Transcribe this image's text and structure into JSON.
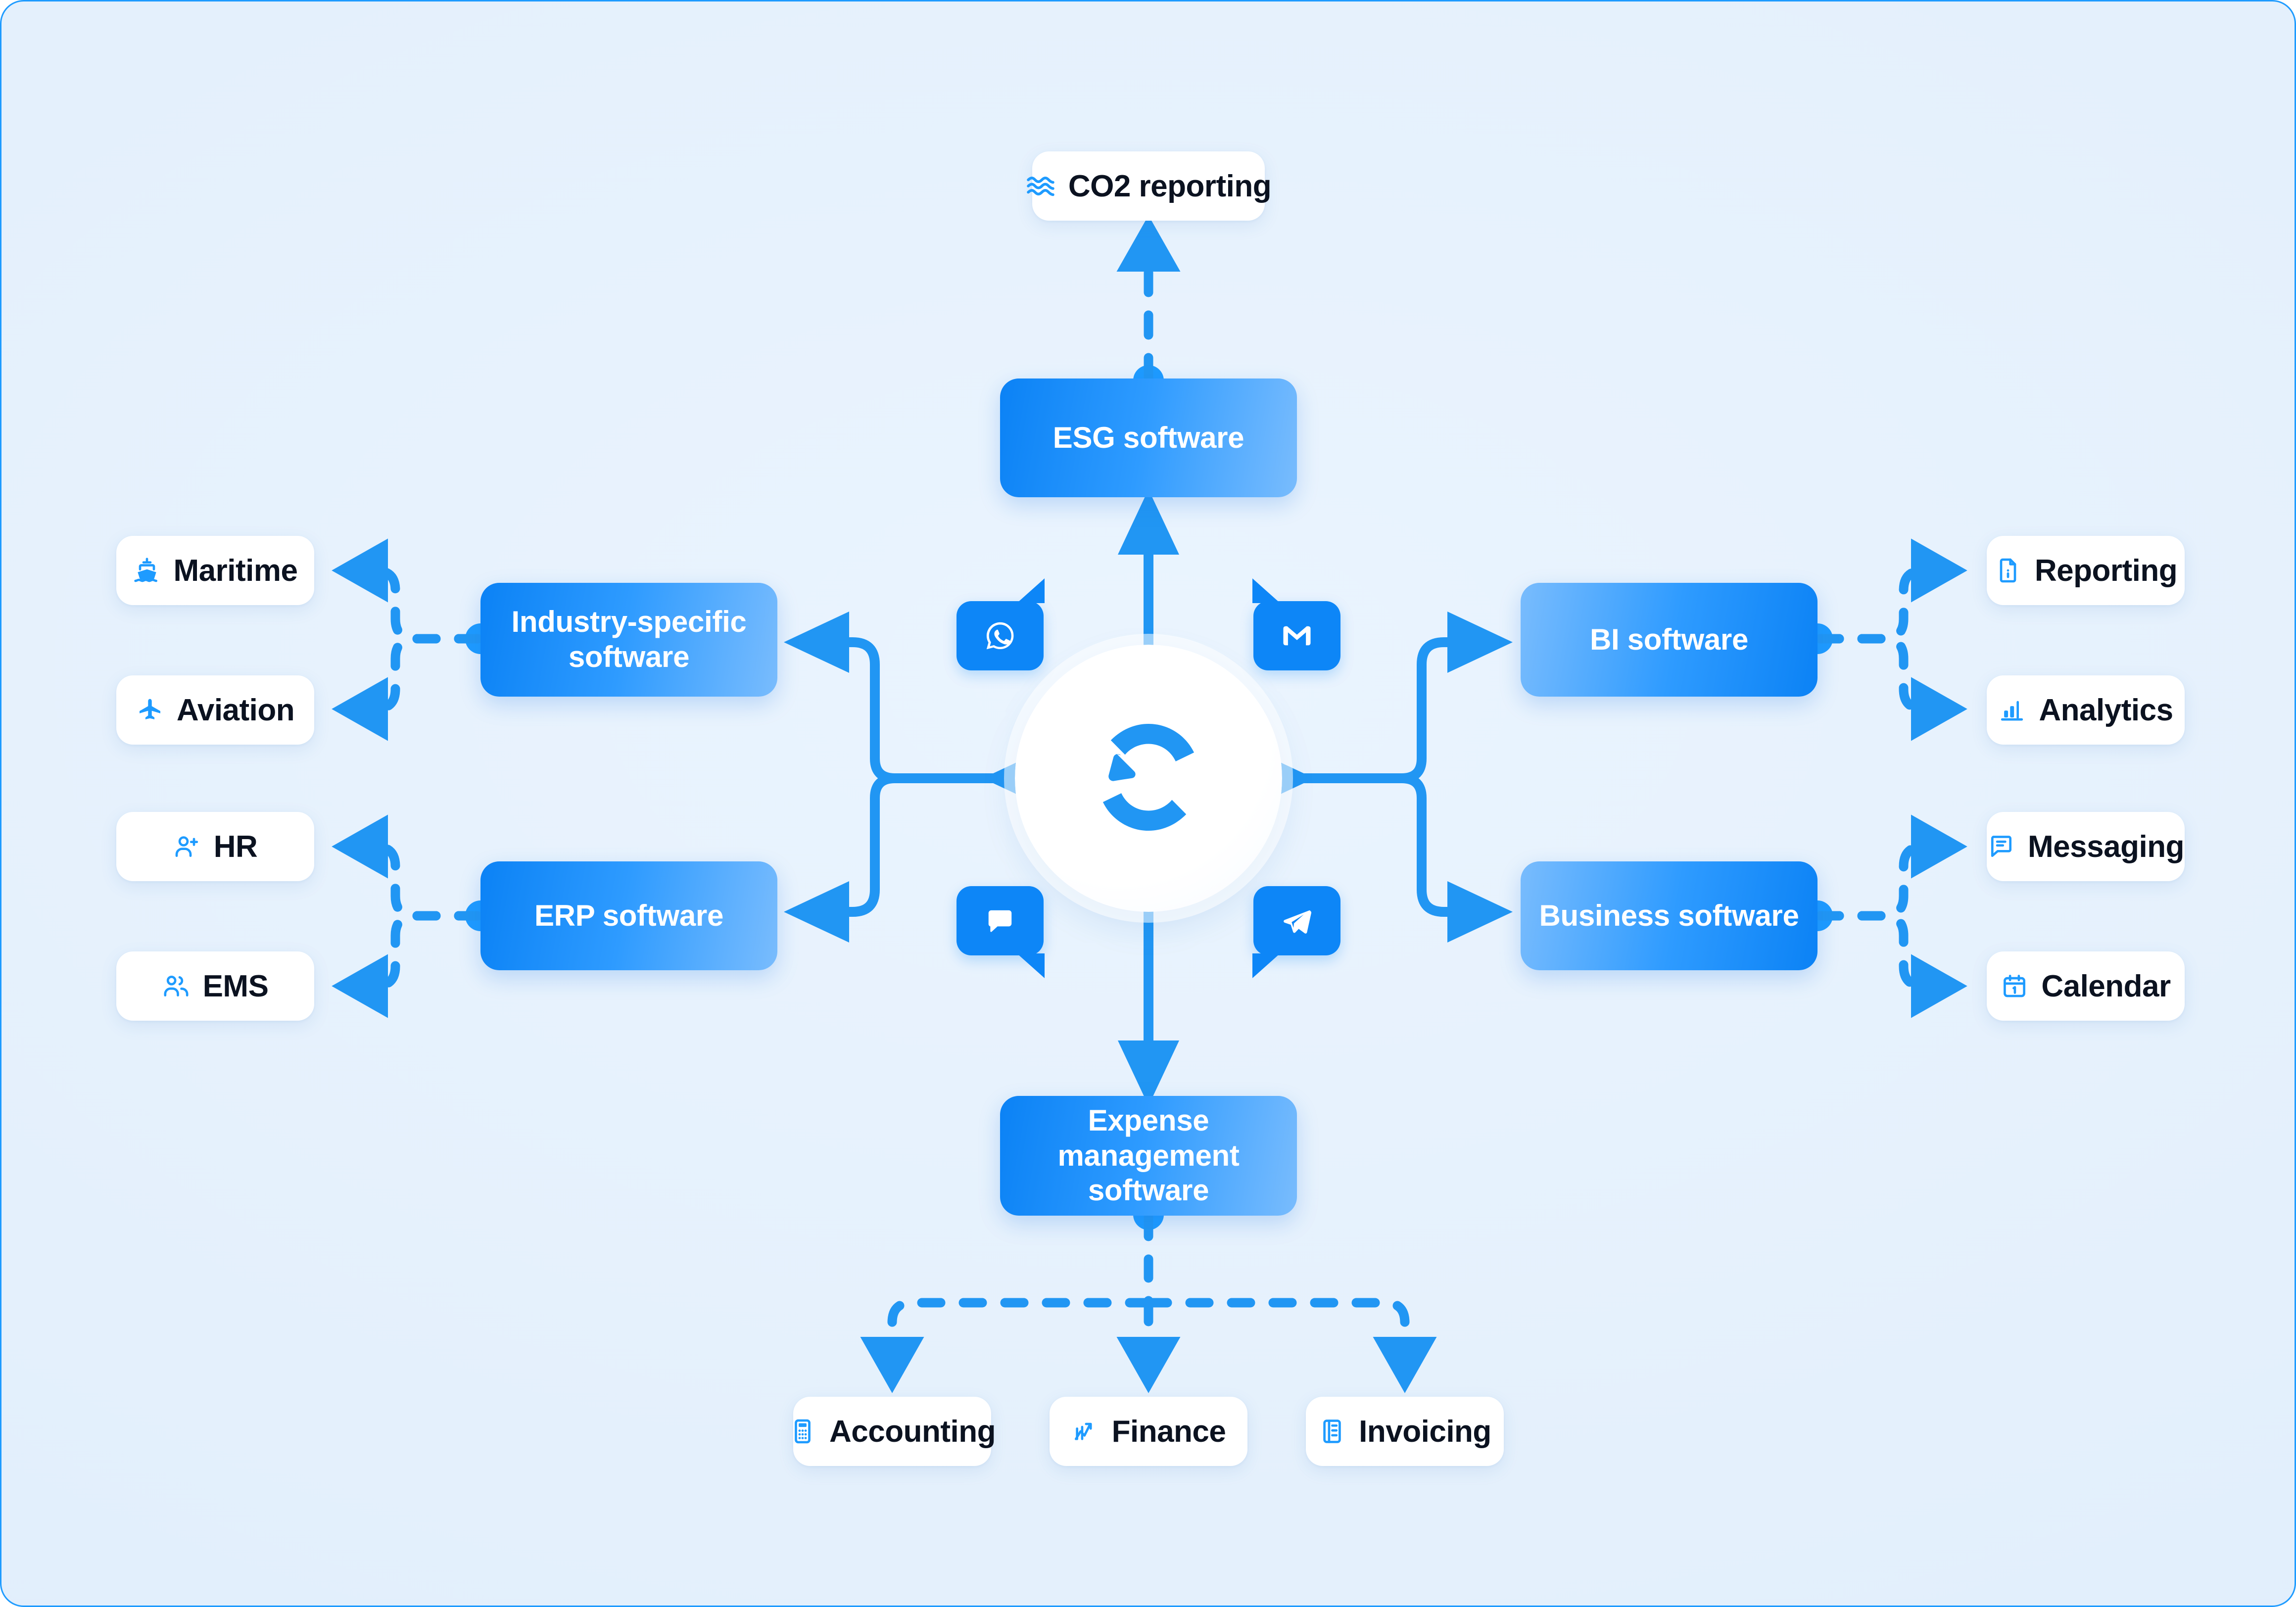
{
  "colors": {
    "accent": "#1e9bff",
    "line": "#2196f3",
    "box_dark": "#0b82f5",
    "box_light": "#79bcfd",
    "card_bg": "#ffffff",
    "page_bg": "#e4f0fc",
    "text_dark": "#0b1220",
    "text_light": "#ffffff"
  },
  "hub": {
    "name": "sync-hub",
    "center_icon": "sync-arrows-icon",
    "bubbles": [
      {
        "id": "whatsapp",
        "icon": "whatsapp-icon",
        "corner": "top-left"
      },
      {
        "id": "gmail",
        "icon": "gmail-icon",
        "corner": "top-right"
      },
      {
        "id": "chat",
        "icon": "chat-bubble-icon",
        "corner": "bottom-left"
      },
      {
        "id": "telegram",
        "icon": "telegram-icon",
        "corner": "bottom-right"
      }
    ]
  },
  "nodes": {
    "co2_reporting": {
      "label": "CO2 reporting",
      "icon": "waves-icon"
    },
    "esg_software": {
      "label": "ESG software"
    },
    "industry_specific_software": {
      "label": "Industry-specific software"
    },
    "erp_software": {
      "label": "ERP software"
    },
    "bi_software": {
      "label": "BI software"
    },
    "business_software": {
      "label": "Business software"
    },
    "expense_management_software": {
      "label": "Expense management software"
    },
    "maritime": {
      "label": "Maritime",
      "icon": "ship-icon"
    },
    "aviation": {
      "label": "Aviation",
      "icon": "airplane-icon"
    },
    "hr": {
      "label": "HR",
      "icon": "user-plus-icon"
    },
    "ems": {
      "label": "EMS",
      "icon": "users-icon"
    },
    "reporting": {
      "label": "Reporting",
      "icon": "document-info-icon"
    },
    "analytics": {
      "label": "Analytics",
      "icon": "bar-chart-icon"
    },
    "messaging": {
      "label": "Messaging",
      "icon": "message-lines-icon"
    },
    "calendar": {
      "label": "Calendar",
      "icon": "calendar-icon"
    },
    "accounting": {
      "label": "Accounting",
      "icon": "calculator-icon"
    },
    "finance": {
      "label": "Finance",
      "icon": "trend-chart-icon"
    },
    "invoicing": {
      "label": "Invoicing",
      "icon": "invoice-icon"
    }
  },
  "chart_data": {
    "type": "diagram",
    "title": "",
    "layout": "radial hub-and-spoke integration map",
    "center": "sync-hub",
    "edges": [
      {
        "from": "sync-hub",
        "to": "esg_software",
        "style": "solid",
        "arrows": "both",
        "direction": "up"
      },
      {
        "from": "esg_software",
        "to": "co2_reporting",
        "style": "dashed",
        "arrows": "to",
        "direction": "up"
      },
      {
        "from": "sync-hub",
        "to": "industry_specific_software",
        "style": "solid",
        "arrows": "both",
        "direction": "left"
      },
      {
        "from": "sync-hub",
        "to": "erp_software",
        "style": "solid",
        "arrows": "both",
        "direction": "left"
      },
      {
        "from": "industry_specific_software",
        "to": "maritime",
        "style": "dashed",
        "arrows": "to",
        "direction": "left"
      },
      {
        "from": "industry_specific_software",
        "to": "aviation",
        "style": "dashed",
        "arrows": "to",
        "direction": "left"
      },
      {
        "from": "erp_software",
        "to": "hr",
        "style": "dashed",
        "arrows": "to",
        "direction": "left"
      },
      {
        "from": "erp_software",
        "to": "ems",
        "style": "dashed",
        "arrows": "to",
        "direction": "left"
      },
      {
        "from": "sync-hub",
        "to": "bi_software",
        "style": "solid",
        "arrows": "both",
        "direction": "right"
      },
      {
        "from": "sync-hub",
        "to": "business_software",
        "style": "solid",
        "arrows": "both",
        "direction": "right"
      },
      {
        "from": "bi_software",
        "to": "reporting",
        "style": "dashed",
        "arrows": "to",
        "direction": "right"
      },
      {
        "from": "bi_software",
        "to": "analytics",
        "style": "dashed",
        "arrows": "to",
        "direction": "right"
      },
      {
        "from": "business_software",
        "to": "messaging",
        "style": "dashed",
        "arrows": "to",
        "direction": "right"
      },
      {
        "from": "business_software",
        "to": "calendar",
        "style": "dashed",
        "arrows": "to",
        "direction": "right"
      },
      {
        "from": "sync-hub",
        "to": "expense_management_software",
        "style": "solid",
        "arrows": "both",
        "direction": "down"
      },
      {
        "from": "expense_management_software",
        "to": "accounting",
        "style": "dashed",
        "arrows": "to",
        "direction": "down"
      },
      {
        "from": "expense_management_software",
        "to": "finance",
        "style": "dashed",
        "arrows": "to",
        "direction": "down"
      },
      {
        "from": "expense_management_software",
        "to": "invoicing",
        "style": "dashed",
        "arrows": "to",
        "direction": "down"
      }
    ]
  }
}
